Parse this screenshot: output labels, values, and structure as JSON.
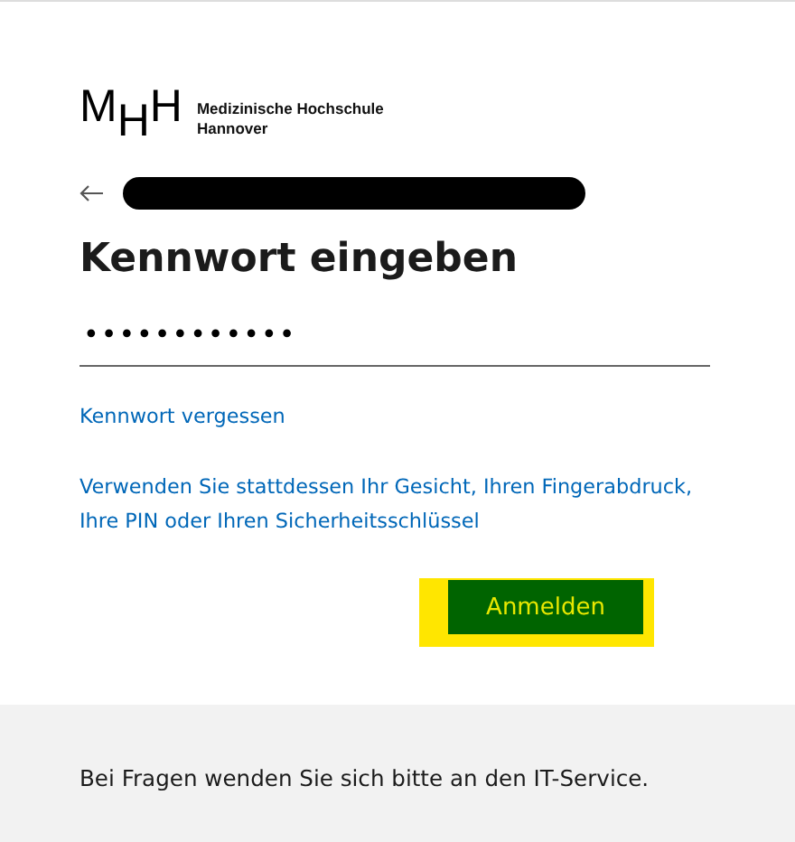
{
  "logo": {
    "mark": "MHH",
    "name_line_1": "Medizinische Hochschule",
    "name_line_2": "Hannover"
  },
  "title": "Kennwort eingeben",
  "password_field": {
    "value": "••••••••••••"
  },
  "links": [
    "Kennwort vergessen",
    "Verwenden Sie stattdessen Ihr Gesicht, Ihren Fingerabdruck, Ihre PIN oder Ihren Sicherheitsschlüssel"
  ],
  "submit_button": {
    "label": "Anmelden",
    "focused": true
  },
  "footer": {
    "text": "Bei Fragen wenden Sie sich bitte an den IT-Service."
  }
}
